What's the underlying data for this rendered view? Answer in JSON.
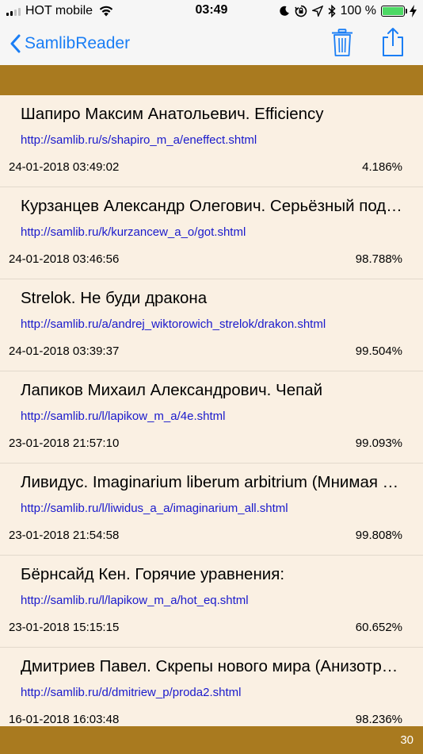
{
  "status_bar": {
    "carrier": "HOT mobile",
    "time": "03:49",
    "battery": "100 %",
    "icons": [
      "signal-icon",
      "wifi-icon",
      "moon-icon",
      "rotation-lock-icon",
      "location-icon",
      "bluetooth-icon",
      "battery-icon",
      "charging-icon"
    ]
  },
  "nav": {
    "back_label": "SamlibReader",
    "icons": [
      "chevron-left-icon",
      "trash-icon",
      "share-icon"
    ],
    "accent_color": "#1a7ef5"
  },
  "colors": {
    "band": "#a97a1f",
    "list_background": "#faf0e3",
    "link": "#1a1acc"
  },
  "items": [
    {
      "title": "Шапиро Максим Анатольевич. Efficiency",
      "url": "http://samlib.ru/s/shapiro_m_a/eneffect.shtml",
      "date": "24-01-2018 03:49:02",
      "percent": "4.186%"
    },
    {
      "title": "Курзанцев Александр Олегович. Серьёзный подход",
      "url": "http://samlib.ru/k/kurzancew_a_o/got.shtml",
      "date": "24-01-2018 03:46:56",
      "percent": "98.788%"
    },
    {
      "title": "Strelok. Не буди дракона",
      "url": "http://samlib.ru/a/andrej_wiktorowich_strelok/drakon.shtml",
      "date": "24-01-2018 03:39:37",
      "percent": "99.504%"
    },
    {
      "title": "Лапиков Михаил Александрович. Чепай",
      "url": "http://samlib.ru/l/lapikow_m_a/4e.shtml",
      "date": "23-01-2018 21:57:10",
      "percent": "99.093%"
    },
    {
      "title": "Ливидус. Imaginarium liberum arbitrium (Мнимая свобода воли)",
      "url": "http://samlib.ru/l/liwidus_a_a/imaginarium_all.shtml",
      "date": "23-01-2018 21:54:58",
      "percent": "99.808%"
    },
    {
      "title": "Бёрнсайд Кен. Горячие уравнения:",
      "url": "http://samlib.ru/l/lapikow_m_a/hot_eq.shtml",
      "date": "23-01-2018 15:15:15",
      "percent": "60.652%"
    },
    {
      "title": "Дмитриев Павел. Скрепы нового мира (Анизотропное шоссе)",
      "url": "http://samlib.ru/d/dmitriew_p/proda2.shtml",
      "date": "16-01-2018 16:03:48",
      "percent": "98.236%"
    }
  ],
  "footer": {
    "count": "30"
  }
}
